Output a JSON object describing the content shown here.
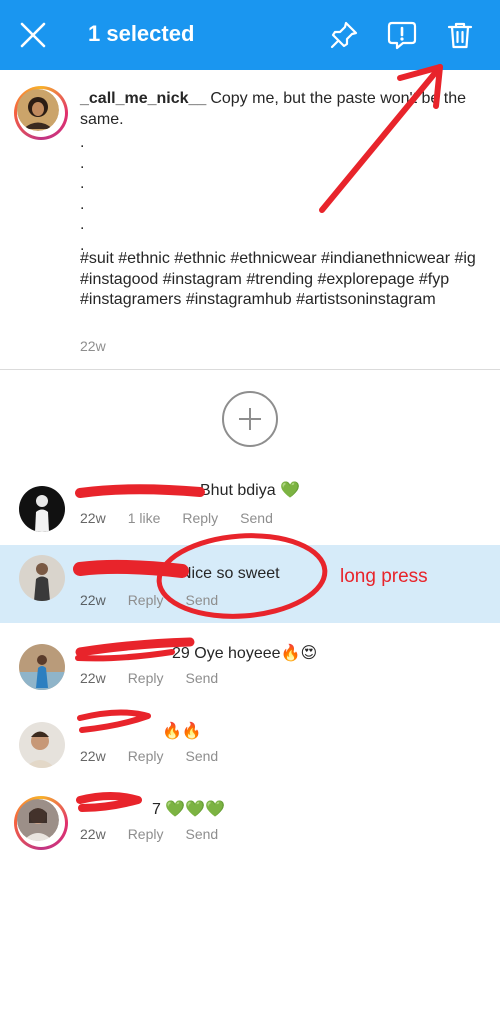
{
  "topbar": {
    "title": "1 selected",
    "icons": [
      "close-icon",
      "pin-icon",
      "report-icon",
      "trash-icon"
    ],
    "color": "#1a96f0"
  },
  "caption": {
    "username": "_call_me_nick__",
    "text": "Copy me, but the paste won't be the same.",
    "dots": [
      ".",
      ".",
      ".",
      ".",
      ".",
      "."
    ],
    "hashtags": "#suit #ethnic #ethnic #ethnicwear #indianethnicwear #ig #instagood #instagram #trending #explorepage #fyp #instagramers #instagramhub #artistsoninstagram",
    "time": "22w"
  },
  "comments": [
    {
      "username": "",
      "text": "Bhut bdiya 💚",
      "time": "22w",
      "likes": "1 like",
      "reply": "Reply",
      "send": "Send",
      "selected": false
    },
    {
      "username": "",
      "text": "Nice so sweet",
      "time": "22w",
      "likes": "",
      "reply": "Reply",
      "send": "Send",
      "selected": true
    },
    {
      "username": "",
      "text": "29 Oye hoyeee🔥😍",
      "time": "22w",
      "likes": "",
      "reply": "Reply",
      "send": "Send",
      "selected": false
    },
    {
      "username": "",
      "text": "🔥🔥",
      "time": "22w",
      "likes": "",
      "reply": "Reply",
      "send": "Send",
      "selected": false
    },
    {
      "username": "",
      "text": "7 💚💚💚",
      "time": "22w",
      "likes": "",
      "reply": "Reply",
      "send": "Send",
      "selected": false
    }
  ],
  "annotation": {
    "label": "long press",
    "color": "#e8242b"
  }
}
